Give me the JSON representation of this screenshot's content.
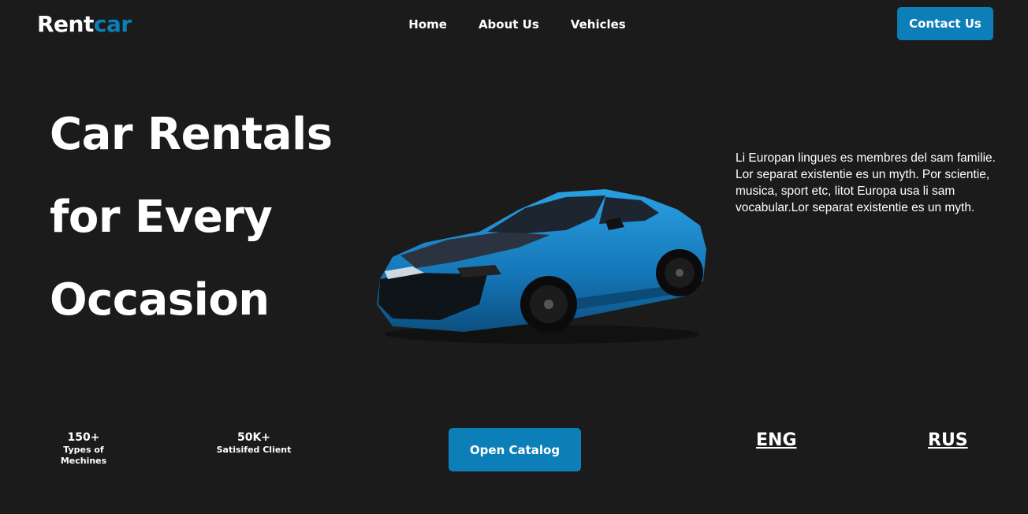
{
  "header": {
    "logo_main": "Rent",
    "logo_accent": "car",
    "nav": [
      "Home",
      "About Us",
      "Vehicles"
    ],
    "contact_label": "Contact Us"
  },
  "hero": {
    "title_lines": [
      "Car Rentals",
      "for Every",
      "Occasion"
    ],
    "description": "Li Europan lingues es membres del sam familie. Lor separat existentie es un myth. Por scientie, musica, sport etc, litot Europa usa li sam vocabular.Lor separat existentie es un myth."
  },
  "stats": [
    {
      "value": "150+",
      "label": "Types of Mechines"
    },
    {
      "value": "50K+",
      "label": "Satisifed Client"
    }
  ],
  "catalog_label": "Open Catalog",
  "languages": [
    "ENG",
    "RUS"
  ],
  "colors": {
    "accent": "#0c7fb8",
    "background": "#1b1b1b",
    "car_body": "#1a86c8"
  }
}
